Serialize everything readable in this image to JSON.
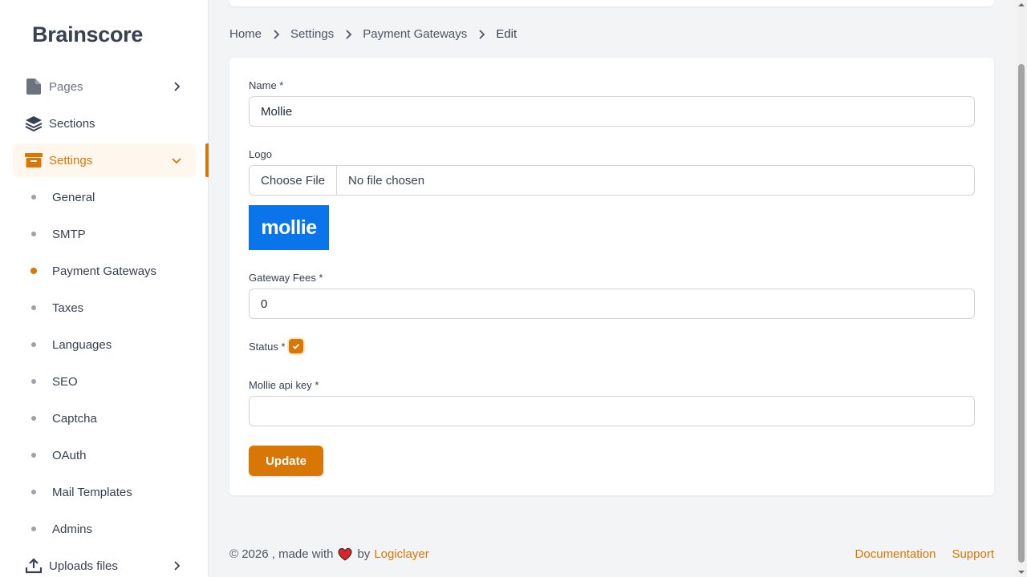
{
  "app": {
    "brand": "Brainscore"
  },
  "sidebar": {
    "items": [
      {
        "label": "Pages",
        "icon": "document-icon",
        "has_chevron": true
      },
      {
        "label": "Sections",
        "icon": "layers-icon"
      },
      {
        "label": "Settings",
        "icon": "archive-box-icon",
        "active": true,
        "expanded": true
      },
      {
        "label": "Uploads files",
        "icon": "upload-icon",
        "has_chevron": true
      }
    ],
    "settings_children": [
      "General",
      "SMTP",
      "Payment Gateways",
      "Taxes",
      "Languages",
      "SEO",
      "Captcha",
      "OAuth",
      "Mail Templates",
      "Admins"
    ],
    "current_child": "Payment Gateways"
  },
  "breadcrumb": [
    "Home",
    "Settings",
    "Payment Gateways",
    "Edit"
  ],
  "form": {
    "name_label": "Name *",
    "name_value": "Mollie",
    "logo_label": "Logo",
    "file_button": "Choose File",
    "file_status": "No file chosen",
    "logo_text": "mollie",
    "fees_label": "Gateway Fees *",
    "fees_value": "0",
    "status_label": "Status *",
    "status_checked": true,
    "api_key_label": "Mollie api key *",
    "api_key_value": "",
    "update_button": "Update"
  },
  "footer": {
    "copyright": "© 2026 , made with",
    "by": "by",
    "brand_link": "Logiclayer",
    "links": [
      "Documentation",
      "Support"
    ]
  },
  "colors": {
    "accent": "#d97706",
    "mollie_blue": "#0a74ea"
  }
}
